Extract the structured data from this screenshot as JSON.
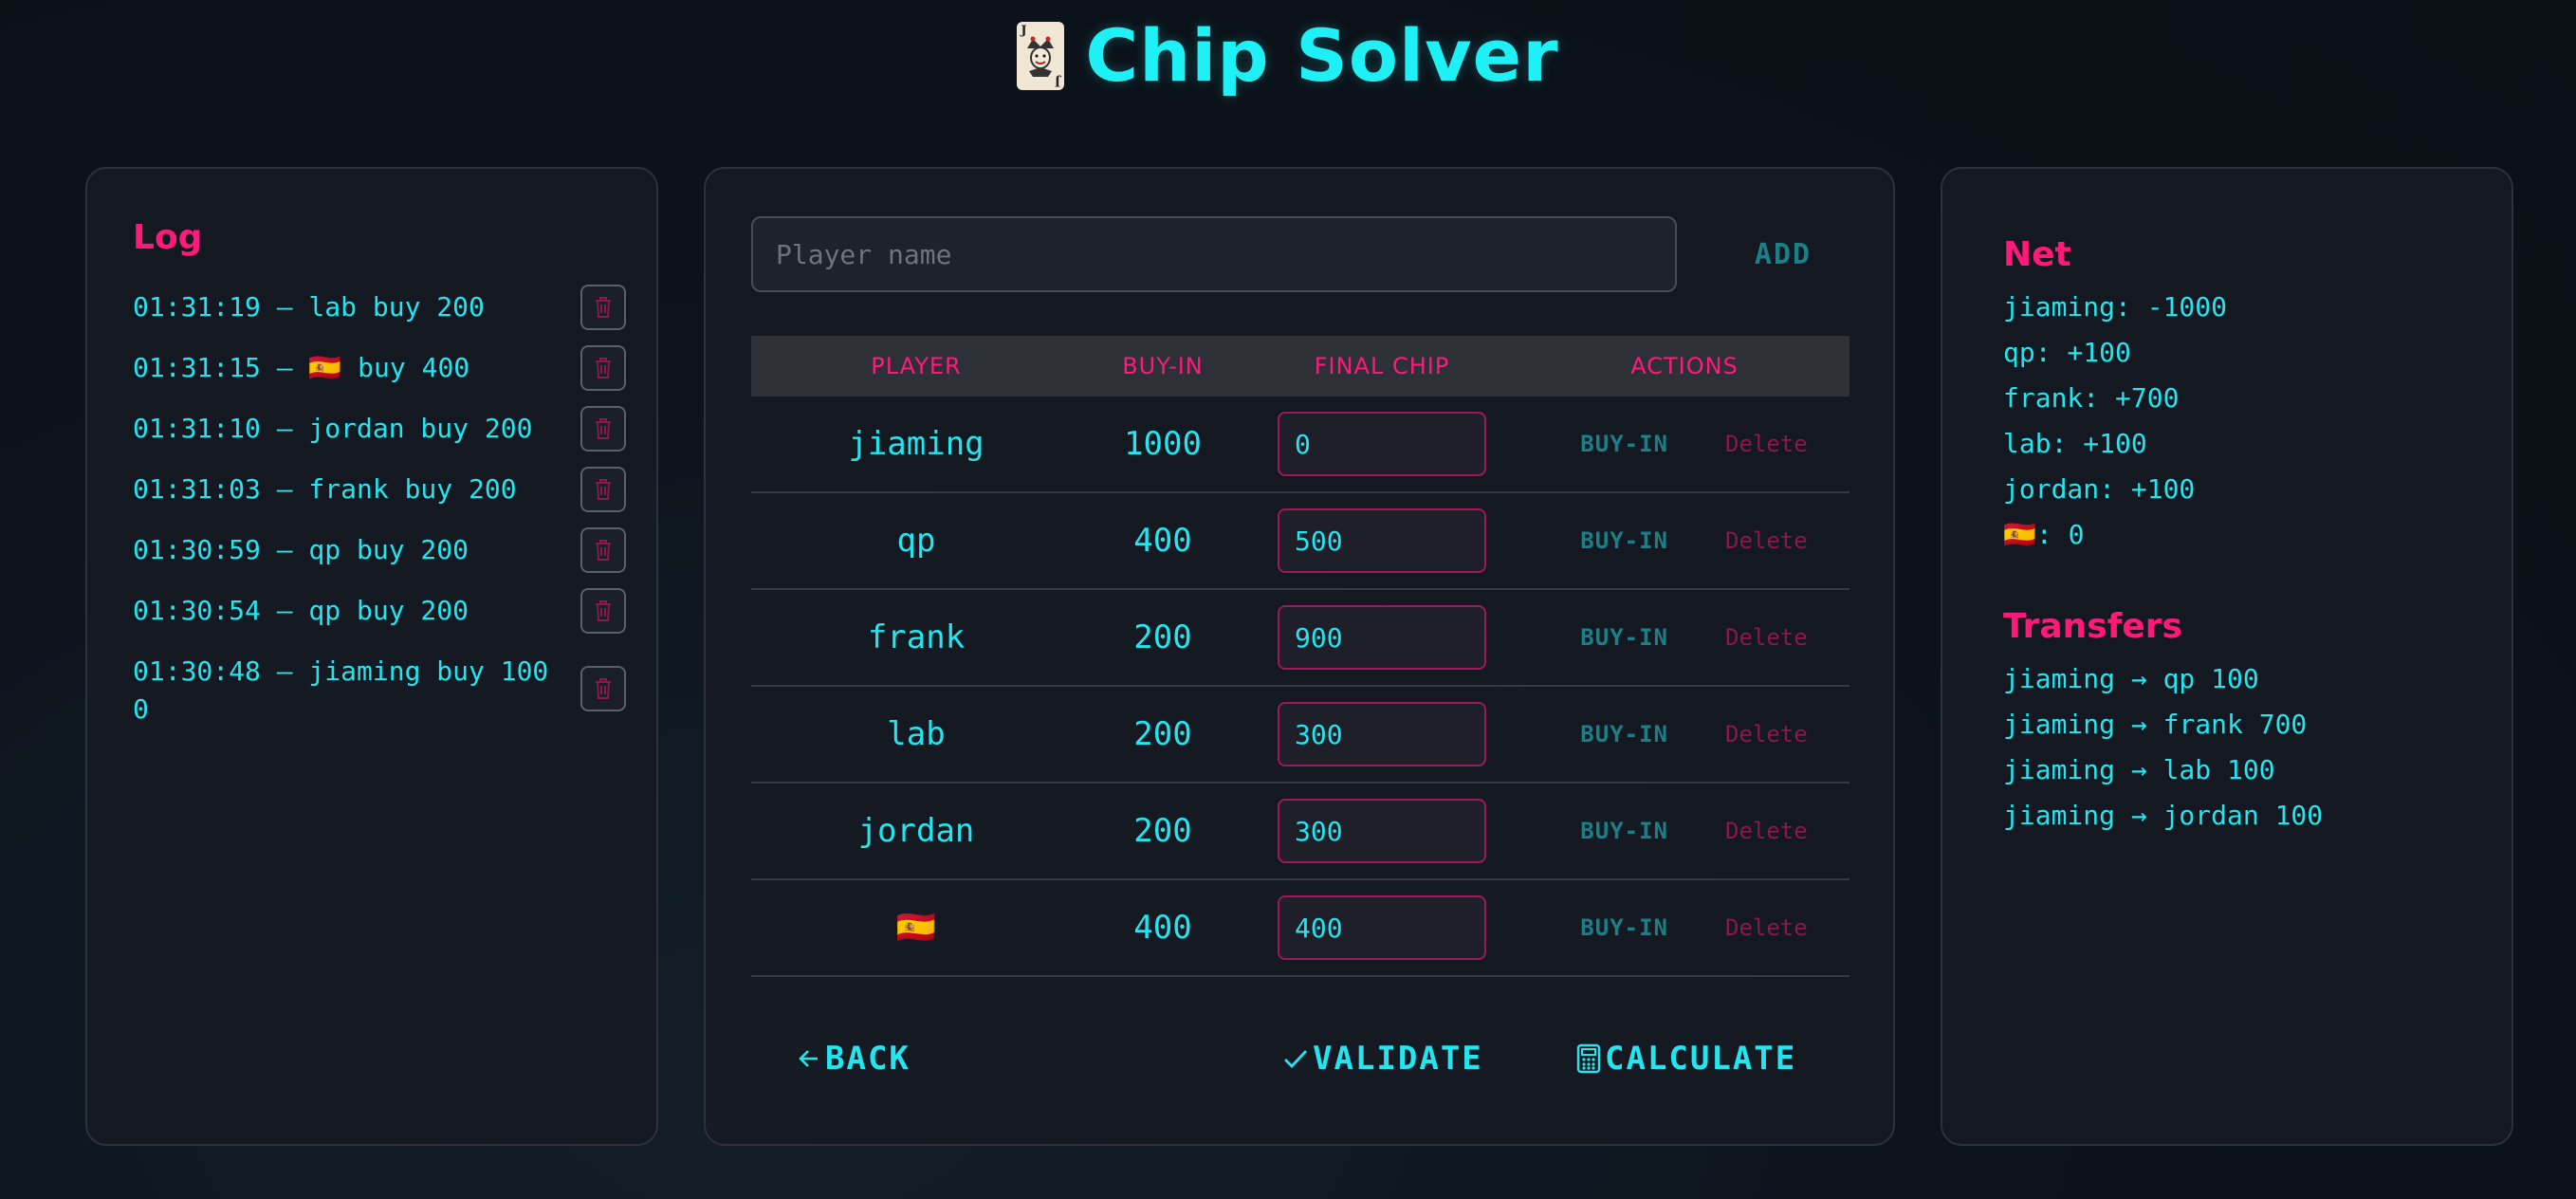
{
  "app": {
    "title": "Chip Solver",
    "icon": "joker-card-icon"
  },
  "log": {
    "heading": "Log",
    "entries": [
      {
        "time": "01:31:19",
        "text": "01:31:19 — lab buy 200"
      },
      {
        "time": "01:31:15",
        "text": "01:31:15 — 🇪🇸 buy 400"
      },
      {
        "time": "01:31:10",
        "text": "01:31:10 — jordan buy 200"
      },
      {
        "time": "01:31:03",
        "text": "01:31:03 — frank buy 200"
      },
      {
        "time": "01:30:59",
        "text": "01:30:59 — qp buy 200"
      },
      {
        "time": "01:30:54",
        "text": "01:30:54 — qp buy 200"
      },
      {
        "time": "01:30:48",
        "text": "01:30:48 — jiaming buy 1000"
      }
    ]
  },
  "main": {
    "name_input": {
      "placeholder": "Player name",
      "value": ""
    },
    "add_label": "ADD",
    "columns": [
      "PLAYER",
      "BUY-IN",
      "FINAL CHIP",
      "ACTIONS"
    ],
    "rows": [
      {
        "player": "jiaming",
        "buyin": "1000",
        "final": "0"
      },
      {
        "player": "qp",
        "buyin": "400",
        "final": "500"
      },
      {
        "player": "frank",
        "buyin": "200",
        "final": "900"
      },
      {
        "player": "lab",
        "buyin": "200",
        "final": "300"
      },
      {
        "player": "jordan",
        "buyin": "200",
        "final": "300"
      },
      {
        "player": "🇪🇸",
        "buyin": "400",
        "final": "400"
      }
    ],
    "row_buyin_label": "BUY-IN",
    "row_delete_label": "Delete",
    "back_label": "BACK",
    "validate_label": "VALIDATE",
    "calculate_label": "CALCULATE"
  },
  "net": {
    "heading": "Net",
    "items": [
      "jiaming: -1000",
      "qp: +100",
      "frank: +700",
      "lab: +100",
      "jordan: +100",
      "🇪🇸: 0"
    ],
    "transfers_heading": "Transfers",
    "transfers": [
      "jiaming → qp 100",
      "jiaming → frank 700",
      "jiaming → lab 100",
      "jiaming → jordan 100"
    ]
  },
  "colors": {
    "accent_cyan": "#22e5ef",
    "accent_pink": "#ff1a7a",
    "panel_bg": "#161a22"
  }
}
